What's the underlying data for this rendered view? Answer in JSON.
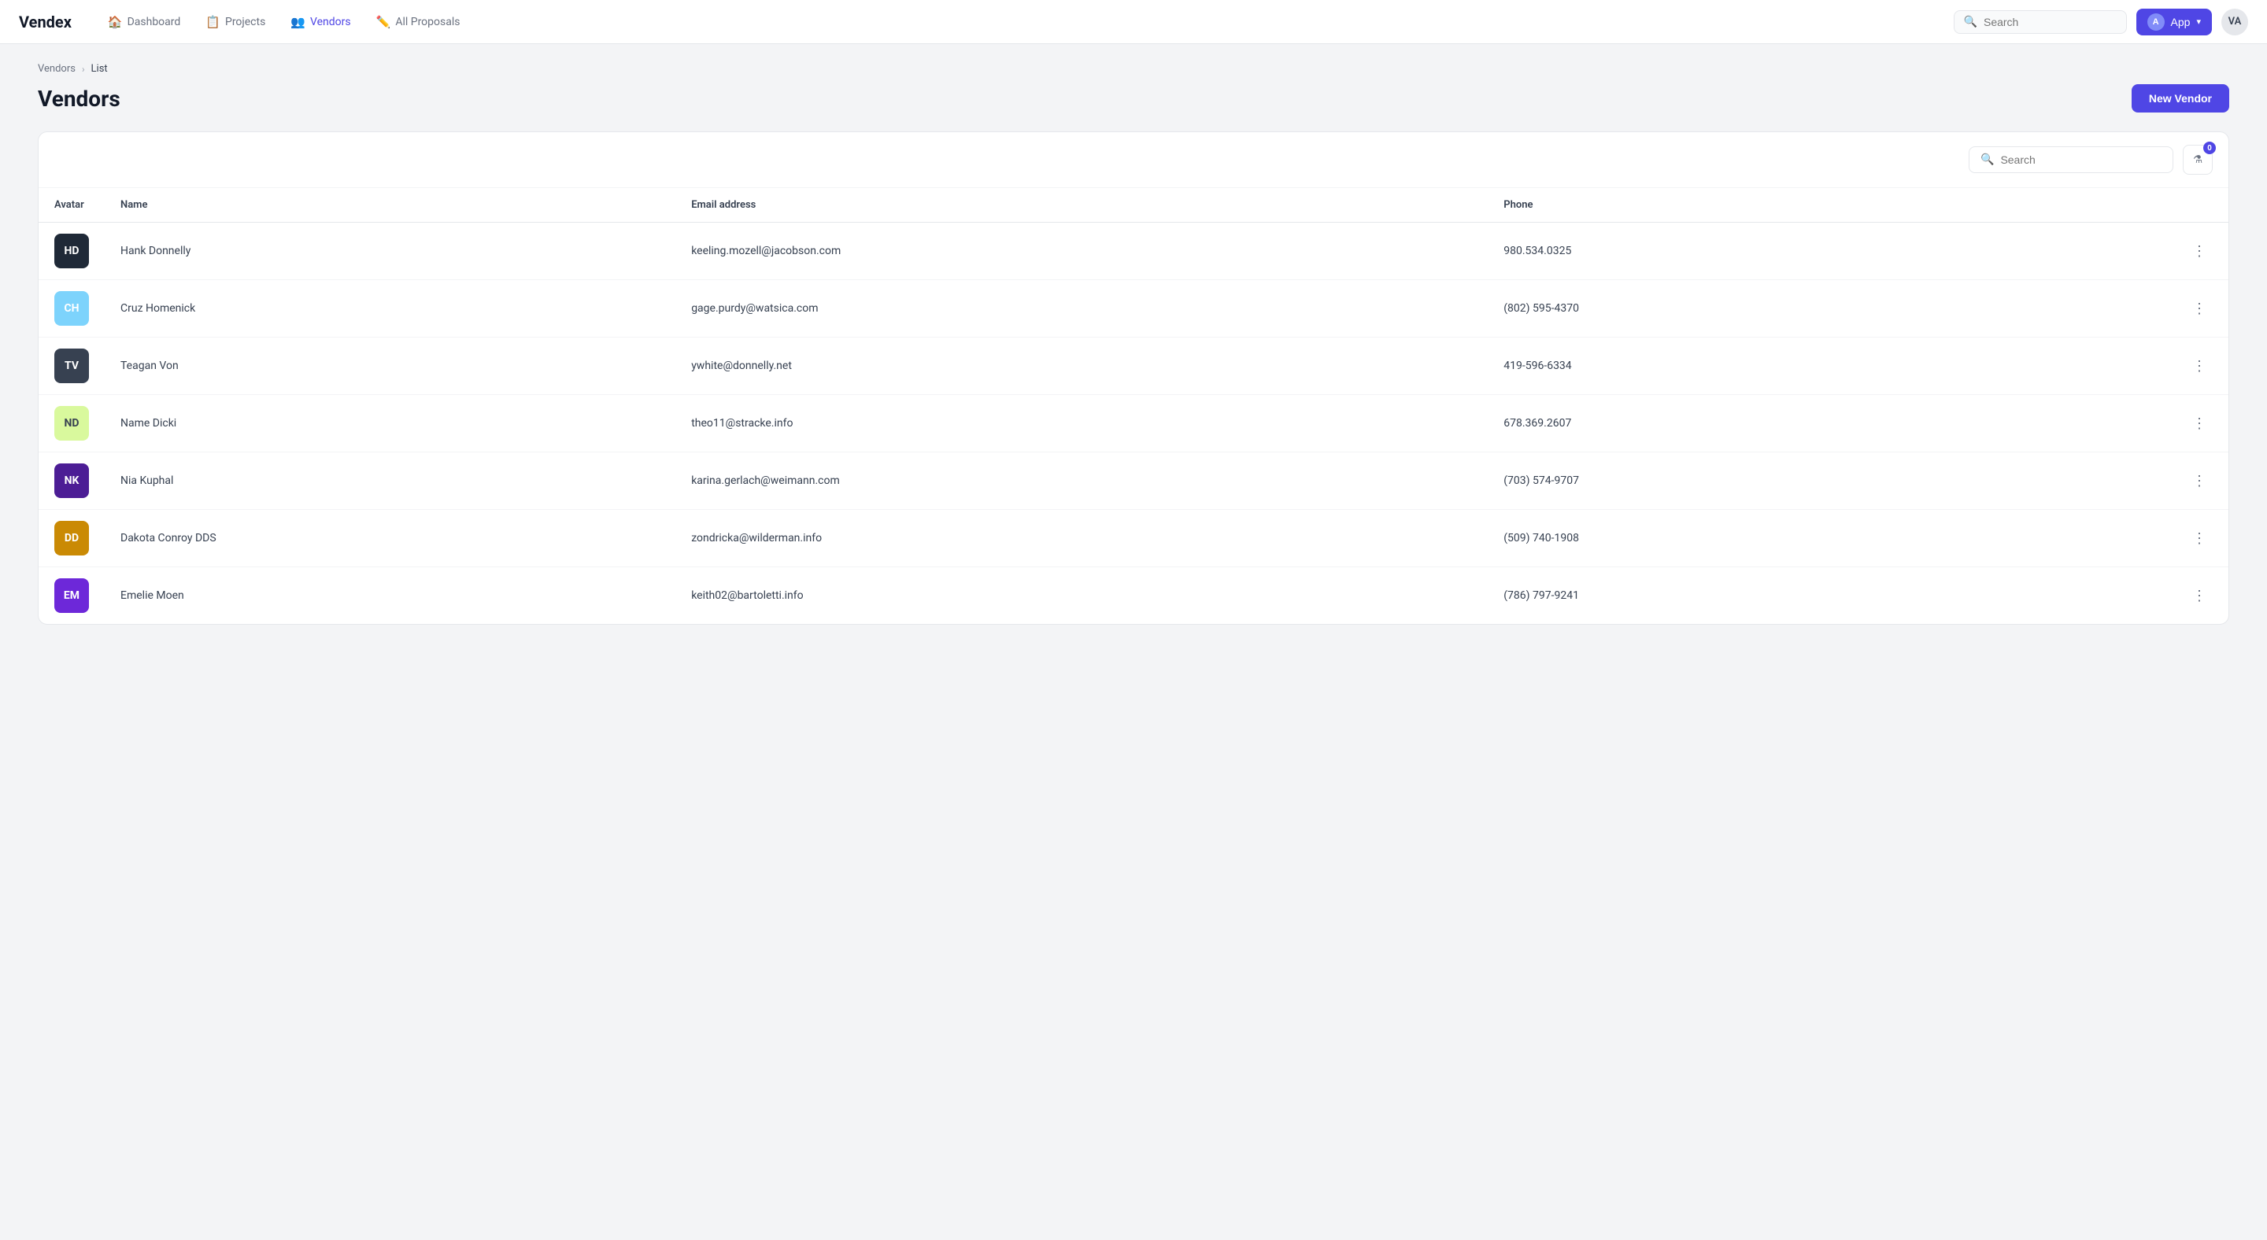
{
  "brand": "Vendex",
  "nav": {
    "links": [
      {
        "id": "dashboard",
        "label": "Dashboard",
        "icon": "🏠",
        "active": false
      },
      {
        "id": "projects",
        "label": "Projects",
        "icon": "📋",
        "active": false
      },
      {
        "id": "vendors",
        "label": "Vendors",
        "icon": "👥",
        "active": true
      },
      {
        "id": "proposals",
        "label": "All Proposals",
        "icon": "✏️",
        "active": false
      }
    ],
    "search_placeholder": "Search",
    "app_button_label": "App",
    "app_avatar": "A",
    "user_initials": "VA"
  },
  "breadcrumb": {
    "parent": "Vendors",
    "separator": "›",
    "current": "List"
  },
  "page": {
    "title": "Vendors",
    "new_vendor_label": "New Vendor"
  },
  "toolbar": {
    "search_placeholder": "Search",
    "filter_count": "0"
  },
  "table": {
    "columns": [
      {
        "id": "avatar",
        "label": "Avatar"
      },
      {
        "id": "name",
        "label": "Name"
      },
      {
        "id": "email",
        "label": "Email address"
      },
      {
        "id": "phone",
        "label": "Phone"
      },
      {
        "id": "actions",
        "label": ""
      }
    ],
    "rows": [
      {
        "id": "hd",
        "initials": "HD",
        "color": "#1f2937",
        "name": "Hank Donnelly",
        "email": "keeling.mozell@jacobson.com",
        "phone": "980.534.0325"
      },
      {
        "id": "ch",
        "initials": "CH",
        "color": "#7dd3fc",
        "name": "Cruz Homenick",
        "email": "gage.purdy@watsica.com",
        "phone": "(802) 595-4370"
      },
      {
        "id": "tv",
        "initials": "TV",
        "color": "#374151",
        "name": "Teagan Von",
        "email": "ywhite@donnelly.net",
        "phone": "419-596-6334"
      },
      {
        "id": "nd",
        "initials": "ND",
        "color": "#d9f99d",
        "text_color": "#374151",
        "name": "Name Dicki",
        "email": "theo11@stracke.info",
        "phone": "678.369.2607"
      },
      {
        "id": "nk",
        "initials": "NK",
        "color": "#4c1d95",
        "name": "Nia Kuphal",
        "email": "karina.gerlach@weimann.com",
        "phone": "(703) 574-9707"
      },
      {
        "id": "dd",
        "initials": "DD",
        "color": "#ca8a04",
        "name": "Dakota Conroy DDS",
        "email": "zondricka@wilderman.info",
        "phone": "(509) 740-1908"
      },
      {
        "id": "em",
        "initials": "EM",
        "color": "#6d28d9",
        "name": "Emelie Moen",
        "email": "keith02@bartoletti.info",
        "phone": "(786) 797-9241"
      }
    ]
  }
}
